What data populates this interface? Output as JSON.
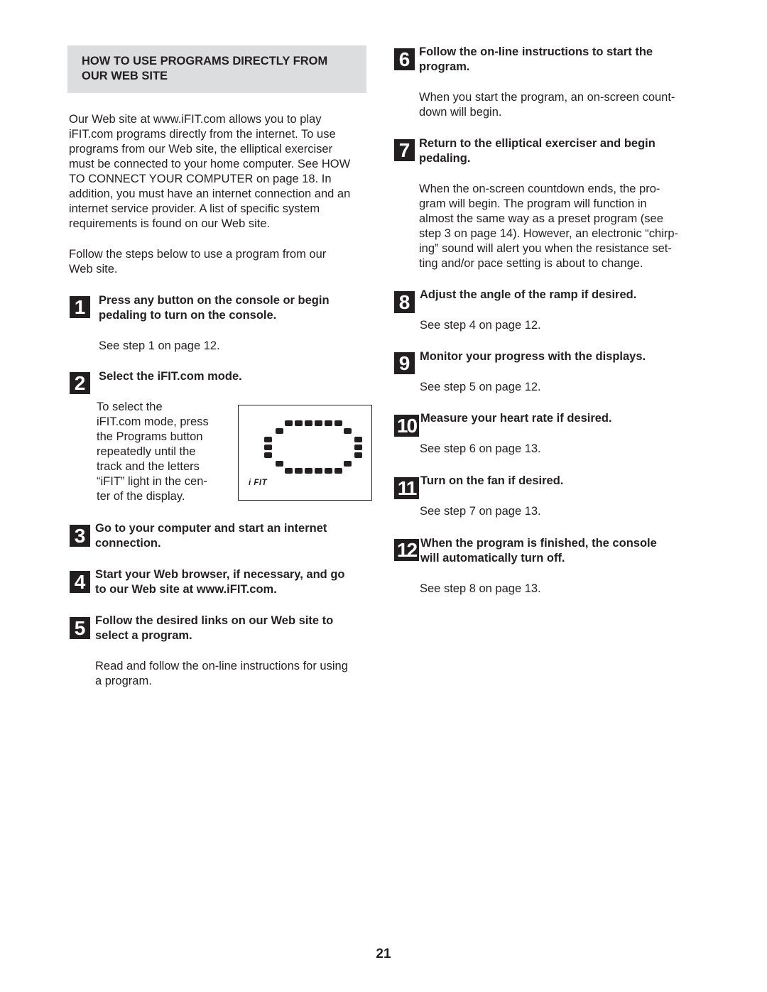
{
  "section": {
    "title_line1": "HOW TO USE PROGRAMS DIRECTLY FROM",
    "title_line2": "OUR WEB SITE"
  },
  "intro": {
    "paragraph1": [
      "Our Web site at www.iFIT.com allows you to play",
      "iFIT.com programs directly from the internet. To use",
      "programs from our Web site, the elliptical exerciser",
      "must be connected to your home computer. See HOW",
      "TO CONNECT YOUR COMPUTER on page 18. In",
      "addition, you must have an internet connection and an",
      "internet service provider. A list of specific system",
      "requirements is found on our Web site."
    ],
    "paragraph2": [
      "Follow the steps below to use a program from our",
      "Web site."
    ]
  },
  "steps": [
    {
      "number": "1",
      "title": [
        "Press any button on the console or begin",
        "pedaling to turn on the console."
      ],
      "body": [
        "See step 1 on page 12."
      ]
    },
    {
      "number": "2",
      "title": [
        "Select the iFIT.com mode."
      ],
      "body": [
        "To select the",
        "iFIT.com mode, press",
        "the Programs button",
        "repeatedly until the",
        "track and the letters",
        "“iFIT” light in the cen-",
        "ter of the display."
      ]
    },
    {
      "number": "3",
      "title": [
        "Go to your computer and start an internet",
        "connection."
      ],
      "body": []
    },
    {
      "number": "4",
      "title": [
        "Start your Web browser, if necessary, and go",
        "to our Web site at www.iFIT.com."
      ],
      "body": []
    },
    {
      "number": "5",
      "title": [
        "Follow the desired links on our Web site to",
        "select a program."
      ],
      "body": [
        "Read and follow the on-line instructions for using",
        "a program."
      ]
    },
    {
      "number": "6",
      "title": [
        "Follow the on-line instructions to start the",
        "program."
      ],
      "body": [
        "When you start the program, an on-screen count-",
        "down will begin."
      ]
    },
    {
      "number": "7",
      "title": [
        "Return to the elliptical exerciser and begin",
        "pedaling."
      ],
      "body": [
        "When the on-screen countdown ends, the pro-",
        "gram will begin. The program will function in",
        "almost the same way as a preset program (see",
        "step 3 on page 14). However, an electronic “chirp-",
        "ing” sound will alert you when the resistance set-",
        "ting and/or pace setting is about to change."
      ]
    },
    {
      "number": "8",
      "title": [
        "Adjust the angle of the ramp if desired."
      ],
      "body": [
        "See step 4 on page 12."
      ]
    },
    {
      "number": "9",
      "title": [
        "Monitor your progress with the displays."
      ],
      "body": [
        "See step 5 on page 12."
      ]
    },
    {
      "number": "10",
      "title": [
        "Measure your heart rate if desired."
      ],
      "body": [
        "See step 6 on page 13."
      ]
    },
    {
      "number": "11",
      "title": [
        "Turn on the fan if desired."
      ],
      "body": [
        "See step 7 on page 13."
      ]
    },
    {
      "number": "12",
      "title": [
        "When the program is finished, the console",
        "will automatically turn off."
      ],
      "body": [
        "See step 8 on page 13."
      ]
    }
  ],
  "display_illustration": {
    "label": "i FIT"
  },
  "page_number": "21"
}
